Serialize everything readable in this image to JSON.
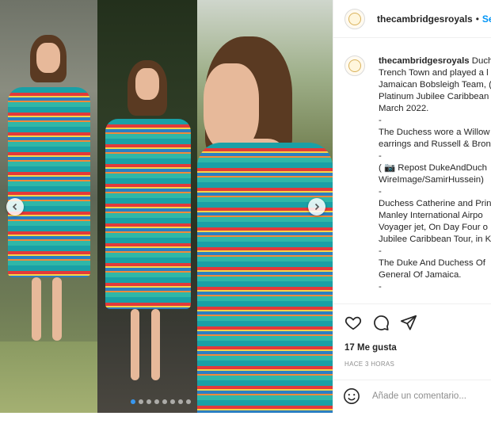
{
  "post": {
    "username": "thecambridgesroyals",
    "separator": "•",
    "follow_label": "Seg",
    "avatar_icon": "royal-crest-logo"
  },
  "caption": {
    "username": "thecambridgesroyals",
    "lines": [
      "Duch",
      "Trench Town and played a l",
      "Jamaican Bobsleigh Team, (",
      "Platinum Jubilee Caribbean",
      "March 2022.",
      "-",
      "The Duchess wore a Willow",
      "earrings and Russell & Bron",
      "-",
      "( 📷 Repost DukeAndDuch",
      "WireImage/SamirHussein)",
      "-",
      "Duchess Catherine and Prin",
      "Manley International Airpo",
      "Voyager jet, On Day Four o",
      "Jubilee Caribbean Tour, in K",
      "-",
      "The Duke And Duchess Of",
      "General Of Jamaica.",
      "-"
    ]
  },
  "actions": {
    "icons": [
      "heart-icon",
      "comment-icon",
      "share-icon"
    ],
    "likes": "17 Me gusta",
    "time": "HACE 3 HORAS"
  },
  "comment_box": {
    "placeholder": "Añade un comentario..."
  },
  "carousel": {
    "slide_count": 8,
    "active_index": 0,
    "colors": {
      "active_dot": "#3897f0",
      "dress_teal": "#1aa0a6",
      "dress_red": "#e23a3a"
    }
  }
}
